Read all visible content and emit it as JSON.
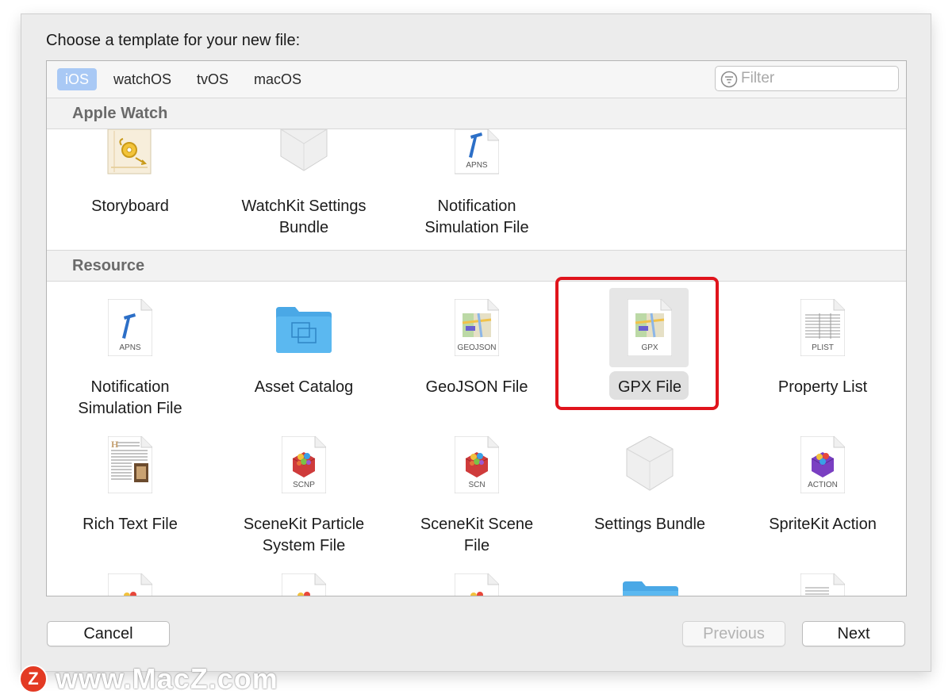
{
  "dialog": {
    "prompt": "Choose a template for your new file:"
  },
  "platform_tabs": [
    {
      "label": "iOS",
      "selected": true
    },
    {
      "label": "watchOS",
      "selected": false
    },
    {
      "label": "tvOS",
      "selected": false
    },
    {
      "label": "macOS",
      "selected": false
    }
  ],
  "filter": {
    "placeholder": "Filter",
    "value": ""
  },
  "sections": {
    "apple_watch": {
      "title": "Apple Watch",
      "items": [
        {
          "label": "Storyboard",
          "icon": "storyboard-icon"
        },
        {
          "label": "WatchKit Settings\nBundle",
          "icon": "lego-brick-icon"
        },
        {
          "label": "Notification\nSimulation File",
          "icon": "apns-file-icon",
          "tag": "APNS"
        }
      ]
    },
    "resource": {
      "title": "Resource",
      "items": [
        {
          "label": "Notification\nSimulation File",
          "icon": "apns-file-icon",
          "tag": "APNS"
        },
        {
          "label": "Asset Catalog",
          "icon": "blue-folder-icon"
        },
        {
          "label": "GeoJSON File",
          "icon": "map-file-icon",
          "tag": "GEOJSON"
        },
        {
          "label": "GPX File",
          "icon": "map-file-icon",
          "tag": "GPX",
          "selected": true
        },
        {
          "label": "Property List",
          "icon": "plist-file-icon",
          "tag": "PLIST"
        },
        {
          "label": "Rich Text File",
          "icon": "rich-text-file-icon"
        },
        {
          "label": "SceneKit Particle\nSystem File",
          "icon": "scenekit-file-icon",
          "tag": "SCNP"
        },
        {
          "label": "SceneKit Scene\nFile",
          "icon": "scenekit-file-icon",
          "tag": "SCN"
        },
        {
          "label": "Settings Bundle",
          "icon": "lego-brick-icon"
        },
        {
          "label": "SpriteKit Action",
          "icon": "spritekit-file-icon",
          "tag": "ACTION"
        }
      ]
    }
  },
  "buttons": {
    "cancel": "Cancel",
    "previous": "Previous",
    "next": "Next"
  },
  "watermark": {
    "logo_letter": "Z",
    "text": "www.MacZ.com"
  },
  "colors": {
    "accent_tab": "#a9c9f5",
    "highlight": "#e0141c",
    "folder_blue": "#4aa8e6",
    "watermark_logo": "#e33a23"
  }
}
